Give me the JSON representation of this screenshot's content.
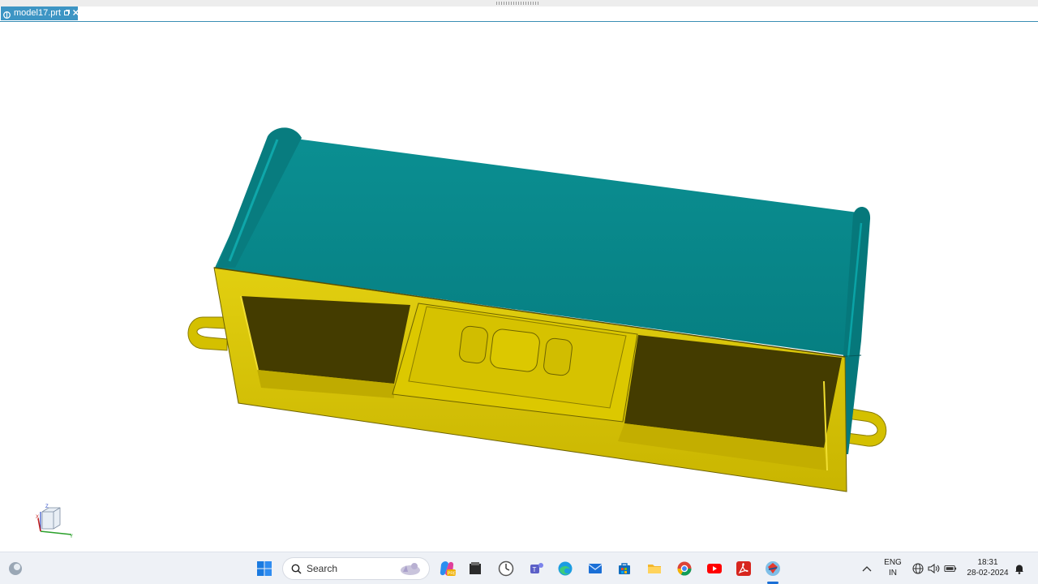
{
  "window": {
    "document_tab": {
      "label": "model17.prt"
    }
  },
  "viewport": {
    "model_colors": {
      "lid": "#06888a",
      "body": "#d9c400",
      "body_shadow": "#443c00"
    },
    "triad": {
      "x_label": "X",
      "y_label": "Y",
      "z_label": "Z"
    }
  },
  "taskbar": {
    "search_placeholder": "Search",
    "pinned_icons": [
      "widgets-icon",
      "start-icon",
      "search-icon",
      "copilot-icon",
      "file-explorer-icon",
      "clock-app-icon",
      "teams-icon",
      "edge-icon",
      "mail-icon",
      "store-icon",
      "folder-icon",
      "chrome-icon",
      "youtube-icon",
      "acrobat-icon",
      "creo-icon"
    ],
    "tray": {
      "lang_line1": "ENG",
      "lang_line2": "IN",
      "time": "18:31",
      "date": "28-02-2024"
    }
  }
}
